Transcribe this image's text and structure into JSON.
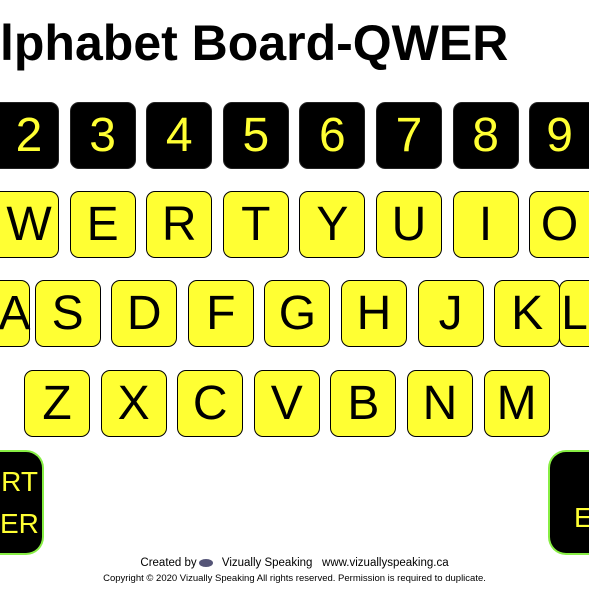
{
  "title": "lphabet Board-QWER",
  "rows": {
    "numbers": [
      "2",
      "3",
      "4",
      "5",
      "6",
      "7",
      "8",
      "9"
    ],
    "top": [
      "W",
      "E",
      "R",
      "T",
      "Y",
      "U",
      "I",
      "O"
    ],
    "middle": [
      "A",
      "S",
      "D",
      "F",
      "G",
      "H",
      "J",
      "K",
      "L"
    ],
    "bottom": [
      "Z",
      "X",
      "C",
      "V",
      "B",
      "N",
      "M"
    ]
  },
  "start_key": {
    "line1": "RT",
    "line2": "ER"
  },
  "enter_key": {
    "label": "E"
  },
  "footer": {
    "created_by": "Created by",
    "logo_icon": "eye-icon",
    "brand": "Vizually Speaking",
    "url": "www.vizuallyspeaking.ca",
    "copyright": "Copyright  ©  2020 Vizually Speaking All rights reserved.  Permission is required to duplicate."
  },
  "colors": {
    "key_yellow": "#ffff33",
    "key_black": "#000000",
    "border_green": "#88ee44"
  }
}
